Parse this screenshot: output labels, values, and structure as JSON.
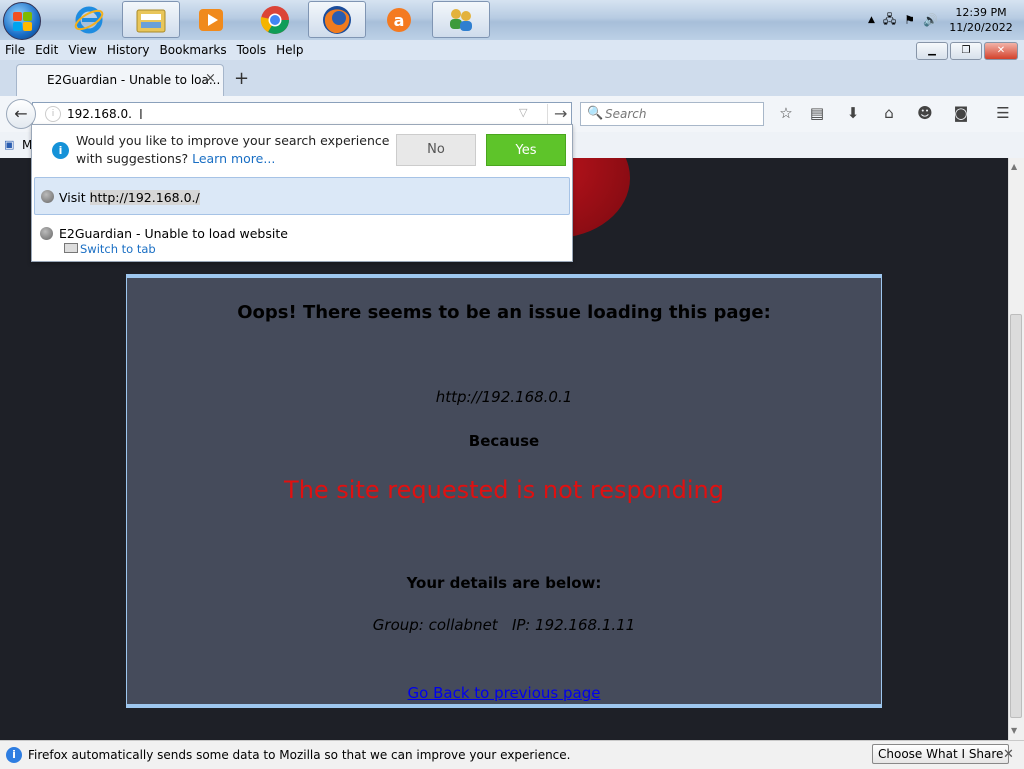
{
  "taskbar": {
    "apps": [
      "start-orb",
      "internet-explorer",
      "file-explorer",
      "media-player",
      "chrome",
      "firefox",
      "avast",
      "network-users"
    ],
    "clock": {
      "time": "12:39 PM",
      "date": "11/20/2022"
    }
  },
  "menubar": {
    "items": [
      {
        "label": "File",
        "key": "F"
      },
      {
        "label": "Edit",
        "key": "E"
      },
      {
        "label": "View",
        "key": "V"
      },
      {
        "label": "History",
        "key": "s"
      },
      {
        "label": "Bookmarks",
        "key": "B"
      },
      {
        "label": "Tools",
        "key": "T"
      },
      {
        "label": "Help",
        "key": "H"
      }
    ]
  },
  "tab": {
    "title": "E2Guardian - Unable to loa...",
    "close": "×",
    "new_tab": "+"
  },
  "navbar": {
    "url_value": "192.168.0.",
    "search_placeholder": "Search"
  },
  "popup": {
    "suggest_line1": "Would you like to improve your search experience",
    "suggest_line2_prefix": "with suggestions? ",
    "learn_more": "Learn more...",
    "no_label": "No",
    "yes_label": "Yes",
    "visit_prefix": "Visit ",
    "visit_url": "http://192.168.0./",
    "result_title": "E2Guardian - Unable to load website",
    "result_action": "Switch to tab"
  },
  "page": {
    "heading": "Oops! There seems to be an issue loading this page:",
    "url": "http://192.168.0.1",
    "because": "Because",
    "reason": "The site requested is not responding",
    "details_heading": "Your details are below:",
    "group_line": "Group: collabnet   IP: 192.168.1.11",
    "back_link": "Go Back to previous page"
  },
  "notification": {
    "text": "Firefox automatically sends some data to Mozilla so that we can improve your experience.",
    "button": "Choose What I Share"
  },
  "colors": {
    "error_red": "#e01010",
    "yes_green": "#5ec42a",
    "card_bg": "#454b5b",
    "page_bg": "#1e2027"
  }
}
